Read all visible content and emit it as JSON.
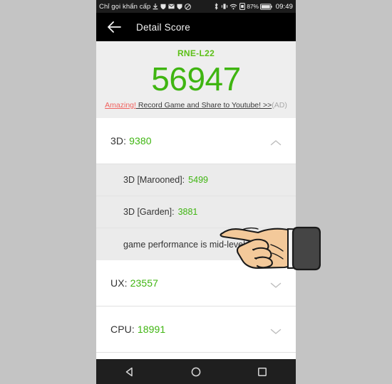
{
  "status_bar": {
    "carrier": "Chỉ gọi khẩn cấp",
    "left_icons": [
      "download-icon",
      "shield-alt-icon",
      "mail-icon",
      "shield-icon",
      "block-icon"
    ],
    "right_icons": [
      "bluetooth-icon",
      "vibrate-icon",
      "wifi-icon",
      "sim-icon"
    ],
    "battery_percent": "87%",
    "battery_icon": "battery-icon",
    "clock": "09:49",
    "background": "#1c1c1c"
  },
  "app_bar": {
    "back_icon": "back-arrow-icon",
    "title": "Detail Score",
    "background": "#000000"
  },
  "score_header": {
    "device_name": "RNE-L22",
    "total_score": "56947",
    "ad": {
      "highlight": "Amazing!",
      "body": " Record Game and Share to Youtube! >>",
      "tag": "(AD)"
    },
    "accent_color": "#3fb511",
    "background": "#eeeeee"
  },
  "sections": [
    {
      "name": "3D",
      "label": "3D: ",
      "value": "9380",
      "expanded": true,
      "chevron": "chevron-up-icon",
      "subitems": [
        {
          "label": "3D [Marooned]: ",
          "value": "5499"
        },
        {
          "label": "3D [Garden]: ",
          "value": "3881"
        }
      ],
      "note": "game performance is mid-level"
    },
    {
      "name": "UX",
      "label": "UX: ",
      "value": "23557",
      "expanded": false,
      "chevron": "chevron-down-icon",
      "subitems": [],
      "note": ""
    },
    {
      "name": "CPU",
      "label": "CPU: ",
      "value": "18991",
      "expanded": false,
      "chevron": "chevron-down-icon",
      "subitems": [],
      "note": ""
    }
  ],
  "nav_bar": {
    "back": "nav-back-icon",
    "home": "nav-home-icon",
    "recents": "nav-recents-icon",
    "background": "#1f1f1f"
  },
  "cursor": {
    "type": "pointing-hand-cursor",
    "skin_color": "#f3c99a",
    "cuff_color": "#454545"
  },
  "page_background": "#c4c4c4"
}
